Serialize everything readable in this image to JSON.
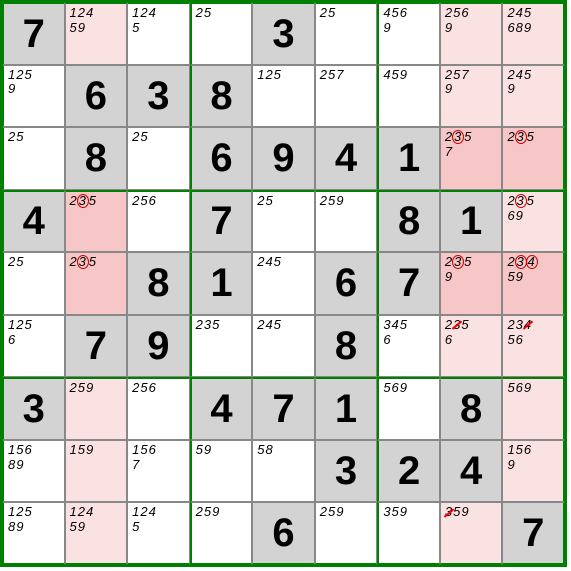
{
  "grid": [
    [
      {
        "big": "7",
        "bg": "gray"
      },
      {
        "cand": [
          {
            "t": "1"
          },
          {
            "t": "2"
          },
          {
            "t": "4"
          },
          {
            "t": "5"
          },
          {
            "t": "9"
          }
        ],
        "bg": "lpink"
      },
      {
        "cand": [
          {
            "t": "1"
          },
          {
            "t": "2"
          },
          {
            "t": "4"
          },
          {
            "t": "5"
          }
        ],
        "bg": "white"
      },
      {
        "cand": [
          {
            "t": "2"
          },
          {
            "t": "5"
          }
        ],
        "bg": "white"
      },
      {
        "big": "3",
        "bg": "gray"
      },
      {
        "cand": [
          {
            "t": "2"
          },
          {
            "t": "5"
          }
        ],
        "bg": "white"
      },
      {
        "cand": [
          {
            "t": "4"
          },
          {
            "t": "5"
          },
          {
            "t": "6"
          },
          {
            "t": "9"
          }
        ],
        "bg": "white"
      },
      {
        "cand": [
          {
            "t": "2"
          },
          {
            "t": "5"
          },
          {
            "t": "6"
          },
          {
            "t": "9"
          }
        ],
        "bg": "lpink"
      },
      {
        "cand": [
          {
            "t": "2"
          },
          {
            "t": "4"
          },
          {
            "t": "5"
          },
          {
            "t": "6"
          },
          {
            "t": "8"
          },
          {
            "t": "9"
          }
        ],
        "bg": "lpink"
      }
    ],
    [
      {
        "cand": [
          {
            "t": "1"
          },
          {
            "t": "2"
          },
          {
            "t": "5"
          },
          {
            "t": "9"
          }
        ],
        "bg": "white"
      },
      {
        "big": "6",
        "bg": "gray"
      },
      {
        "big": "3",
        "bg": "gray"
      },
      {
        "big": "8",
        "bg": "gray"
      },
      {
        "cand": [
          {
            "t": "1"
          },
          {
            "t": "2"
          },
          {
            "t": "5"
          }
        ],
        "bg": "white"
      },
      {
        "cand": [
          {
            "t": "2"
          },
          {
            "t": "5"
          },
          {
            "t": "7"
          }
        ],
        "bg": "white"
      },
      {
        "cand": [
          {
            "t": "4"
          },
          {
            "t": "5"
          },
          {
            "t": "9"
          }
        ],
        "bg": "white"
      },
      {
        "cand": [
          {
            "t": "2"
          },
          {
            "t": "5"
          },
          {
            "t": "7"
          },
          {
            "t": "9"
          }
        ],
        "bg": "lpink"
      },
      {
        "cand": [
          {
            "t": "2"
          },
          {
            "t": "4"
          },
          {
            "t": "5"
          },
          {
            "t": "9"
          }
        ],
        "bg": "lpink"
      }
    ],
    [
      {
        "cand": [
          {
            "t": "2"
          },
          {
            "t": "5"
          }
        ],
        "bg": "white"
      },
      {
        "big": "8",
        "bg": "gray"
      },
      {
        "cand": [
          {
            "t": "2"
          },
          {
            "t": "5"
          }
        ],
        "bg": "white"
      },
      {
        "big": "6",
        "bg": "gray"
      },
      {
        "big": "9",
        "bg": "gray"
      },
      {
        "big": "4",
        "bg": "gray"
      },
      {
        "big": "1",
        "bg": "gray"
      },
      {
        "cand": [
          {
            "t": "2"
          },
          {
            "t": "3",
            "c": true
          },
          {
            "t": "5"
          },
          {
            "t": "7"
          }
        ],
        "bg": "pink"
      },
      {
        "cand": [
          {
            "t": "2"
          },
          {
            "t": "3",
            "c": true
          },
          {
            "t": "5"
          }
        ],
        "bg": "pink"
      }
    ],
    [
      {
        "big": "4",
        "bg": "gray"
      },
      {
        "cand": [
          {
            "t": "2"
          },
          {
            "t": "3",
            "c": true
          },
          {
            "t": "5"
          }
        ],
        "bg": "pink"
      },
      {
        "cand": [
          {
            "t": "2"
          },
          {
            "t": "5"
          },
          {
            "t": "6"
          }
        ],
        "bg": "white"
      },
      {
        "big": "7",
        "bg": "gray"
      },
      {
        "cand": [
          {
            "t": "2"
          },
          {
            "t": "5"
          }
        ],
        "bg": "white"
      },
      {
        "cand": [
          {
            "t": "2"
          },
          {
            "t": "5"
          },
          {
            "t": "9"
          }
        ],
        "bg": "white"
      },
      {
        "big": "8",
        "bg": "gray"
      },
      {
        "big": "1",
        "bg": "gray"
      },
      {
        "cand": [
          {
            "t": "2"
          },
          {
            "t": "3",
            "c": true
          },
          {
            "t": "5"
          },
          {
            "t": "6"
          },
          {
            "t": "9"
          }
        ],
        "bg": "lpink"
      }
    ],
    [
      {
        "cand": [
          {
            "t": "2"
          },
          {
            "t": "5"
          }
        ],
        "bg": "white"
      },
      {
        "cand": [
          {
            "t": "2"
          },
          {
            "t": "3",
            "c": true
          },
          {
            "t": "5"
          }
        ],
        "bg": "pink"
      },
      {
        "big": "8",
        "bg": "gray"
      },
      {
        "big": "1",
        "bg": "gray"
      },
      {
        "cand": [
          {
            "t": "2"
          },
          {
            "t": "4"
          },
          {
            "t": "5"
          }
        ],
        "bg": "white"
      },
      {
        "big": "6",
        "bg": "gray"
      },
      {
        "big": "7",
        "bg": "gray"
      },
      {
        "cand": [
          {
            "t": "2"
          },
          {
            "t": "3",
            "c": true
          },
          {
            "t": "5"
          },
          {
            "t": "9"
          }
        ],
        "bg": "pink"
      },
      {
        "cand": [
          {
            "t": "2"
          },
          {
            "t": "3",
            "c": true
          },
          {
            "t": "4",
            "c": true
          },
          {
            "t": "5"
          },
          {
            "t": "9"
          }
        ],
        "bg": "pink"
      }
    ],
    [
      {
        "cand": [
          {
            "t": "1"
          },
          {
            "t": "2"
          },
          {
            "t": "5"
          },
          {
            "t": "6"
          }
        ],
        "bg": "white"
      },
      {
        "big": "7",
        "bg": "gray"
      },
      {
        "big": "9",
        "bg": "gray"
      },
      {
        "cand": [
          {
            "t": "2"
          },
          {
            "t": "3"
          },
          {
            "t": "5"
          }
        ],
        "bg": "white"
      },
      {
        "cand": [
          {
            "t": "2"
          },
          {
            "t": "4"
          },
          {
            "t": "5"
          }
        ],
        "bg": "white"
      },
      {
        "big": "8",
        "bg": "gray"
      },
      {
        "cand": [
          {
            "t": "3"
          },
          {
            "t": "4"
          },
          {
            "t": "5"
          },
          {
            "t": "6"
          }
        ],
        "bg": "white"
      },
      {
        "cand": [
          {
            "t": "2"
          },
          {
            "t": "3",
            "s": true
          },
          {
            "t": "5"
          },
          {
            "t": "6"
          }
        ],
        "bg": "lpink"
      },
      {
        "cand": [
          {
            "t": "2"
          },
          {
            "t": "3"
          },
          {
            "t": "4",
            "s": true
          },
          {
            "t": "5"
          },
          {
            "t": "6"
          }
        ],
        "bg": "lpink"
      }
    ],
    [
      {
        "big": "3",
        "bg": "gray"
      },
      {
        "cand": [
          {
            "t": "2"
          },
          {
            "t": "5"
          },
          {
            "t": "9"
          }
        ],
        "bg": "lpink"
      },
      {
        "cand": [
          {
            "t": "2"
          },
          {
            "t": "5"
          },
          {
            "t": "6"
          }
        ],
        "bg": "white"
      },
      {
        "big": "4",
        "bg": "gray"
      },
      {
        "big": "7",
        "bg": "gray"
      },
      {
        "big": "1",
        "bg": "gray"
      },
      {
        "cand": [
          {
            "t": "5"
          },
          {
            "t": "6"
          },
          {
            "t": "9"
          }
        ],
        "bg": "white"
      },
      {
        "big": "8",
        "bg": "gray"
      },
      {
        "cand": [
          {
            "t": "5"
          },
          {
            "t": "6"
          },
          {
            "t": "9"
          }
        ],
        "bg": "lpink"
      }
    ],
    [
      {
        "cand": [
          {
            "t": "1"
          },
          {
            "t": "5"
          },
          {
            "t": "6"
          },
          {
            "t": "8"
          },
          {
            "t": "9"
          }
        ],
        "bg": "white"
      },
      {
        "cand": [
          {
            "t": "1"
          },
          {
            "t": "5"
          },
          {
            "t": "9"
          }
        ],
        "bg": "lpink"
      },
      {
        "cand": [
          {
            "t": "1"
          },
          {
            "t": "5"
          },
          {
            "t": "6"
          },
          {
            "t": "7"
          }
        ],
        "bg": "white"
      },
      {
        "cand": [
          {
            "t": "5"
          },
          {
            "t": "9"
          }
        ],
        "bg": "white"
      },
      {
        "cand": [
          {
            "t": "5"
          },
          {
            "t": "8"
          }
        ],
        "bg": "white"
      },
      {
        "big": "3",
        "bg": "gray"
      },
      {
        "big": "2",
        "bg": "gray"
      },
      {
        "big": "4",
        "bg": "gray"
      },
      {
        "cand": [
          {
            "t": "1"
          },
          {
            "t": "5"
          },
          {
            "t": "6"
          },
          {
            "t": "9"
          }
        ],
        "bg": "lpink"
      }
    ],
    [
      {
        "cand": [
          {
            "t": "1"
          },
          {
            "t": "2"
          },
          {
            "t": "5"
          },
          {
            "t": "8"
          },
          {
            "t": "9"
          }
        ],
        "bg": "white"
      },
      {
        "cand": [
          {
            "t": "1"
          },
          {
            "t": "2"
          },
          {
            "t": "4"
          },
          {
            "t": "5"
          },
          {
            "t": "9"
          }
        ],
        "bg": "lpink"
      },
      {
        "cand": [
          {
            "t": "1"
          },
          {
            "t": "2"
          },
          {
            "t": "4"
          },
          {
            "t": "5"
          }
        ],
        "bg": "white"
      },
      {
        "cand": [
          {
            "t": "2"
          },
          {
            "t": "5"
          },
          {
            "t": "9"
          }
        ],
        "bg": "white"
      },
      {
        "big": "6",
        "bg": "gray"
      },
      {
        "cand": [
          {
            "t": "2"
          },
          {
            "t": "5"
          },
          {
            "t": "9"
          }
        ],
        "bg": "white"
      },
      {
        "cand": [
          {
            "t": "3"
          },
          {
            "t": "5"
          },
          {
            "t": "9"
          }
        ],
        "bg": "white"
      },
      {
        "cand": [
          {
            "t": "3",
            "s": true
          },
          {
            "t": "5"
          },
          {
            "t": "9"
          }
        ],
        "bg": "lpink"
      },
      {
        "big": "7",
        "bg": "gray"
      }
    ]
  ],
  "colors": {
    "gray": "#d3d3d3",
    "pink": "#f7c6c6",
    "lpink": "#fbe2e2",
    "white": "#ffffff"
  }
}
